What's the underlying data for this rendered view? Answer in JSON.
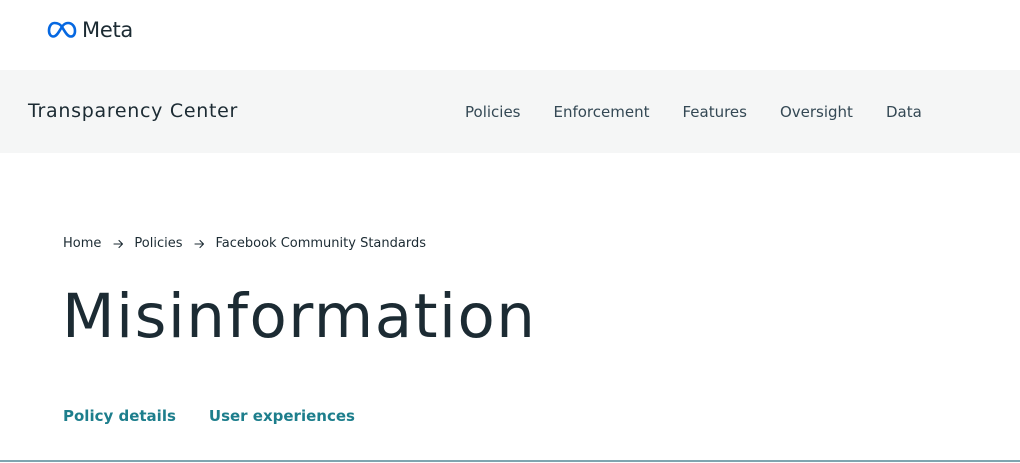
{
  "brand": {
    "name": "Meta",
    "logo_icon": "meta-infinity-icon",
    "logo_color": "#0668e1"
  },
  "nav": {
    "site_title": "Transparency Center",
    "links": [
      {
        "label": "Policies"
      },
      {
        "label": "Enforcement"
      },
      {
        "label": "Features"
      },
      {
        "label": "Oversight"
      },
      {
        "label": "Data"
      }
    ]
  },
  "breadcrumb": {
    "items": [
      {
        "label": "Home"
      },
      {
        "label": "Policies"
      },
      {
        "label": "Facebook Community Standards"
      }
    ],
    "separator_icon": "arrow-right-icon"
  },
  "page": {
    "title": "Misinformation"
  },
  "sub_tabs": [
    {
      "label": "Policy details"
    },
    {
      "label": "User experiences"
    }
  ],
  "colors": {
    "nav_background": "#f5f6f6",
    "text_primary": "#1c2b33",
    "tab_accent": "#1d7e8c",
    "divider": "#7fa5b0"
  }
}
